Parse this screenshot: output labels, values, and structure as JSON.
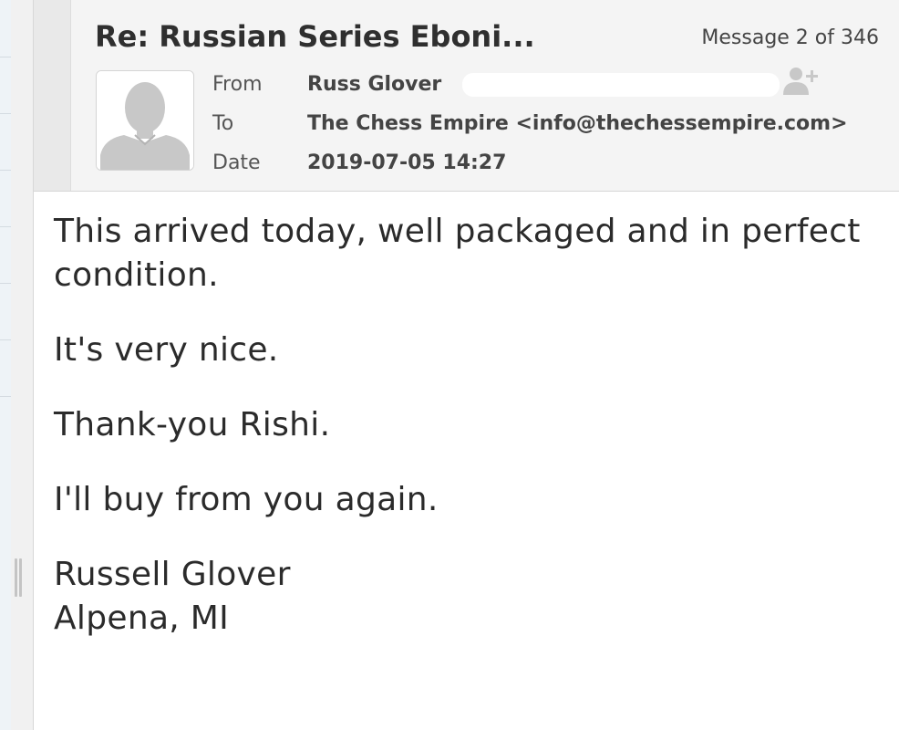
{
  "message": {
    "subject": "Re: Russian Series Eboni...",
    "position_label": "Message 2 of 346",
    "from_label": "From",
    "from_name": "Russ Glover",
    "to_label": "To",
    "to_value": "The Chess Empire <info@thechessempire.com>",
    "date_label": "Date",
    "date_value": "2019-07-05 14:27"
  },
  "body": {
    "para1": "This arrived today, well packaged and in perfect condition.",
    "para2": "It's very nice.",
    "para3": "Thank-you Rishi.",
    "para4": "I'll buy from you again.",
    "signature_name": "Russell Glover",
    "signature_location": "Alpena, MI"
  },
  "icons": {
    "avatar": "person-silhouette-icon",
    "add_contact": "add-contact-icon"
  },
  "colors": {
    "header_bg": "#f4f4f4",
    "text": "#2b2b2b",
    "icon_gray": "#c8c8c8"
  }
}
